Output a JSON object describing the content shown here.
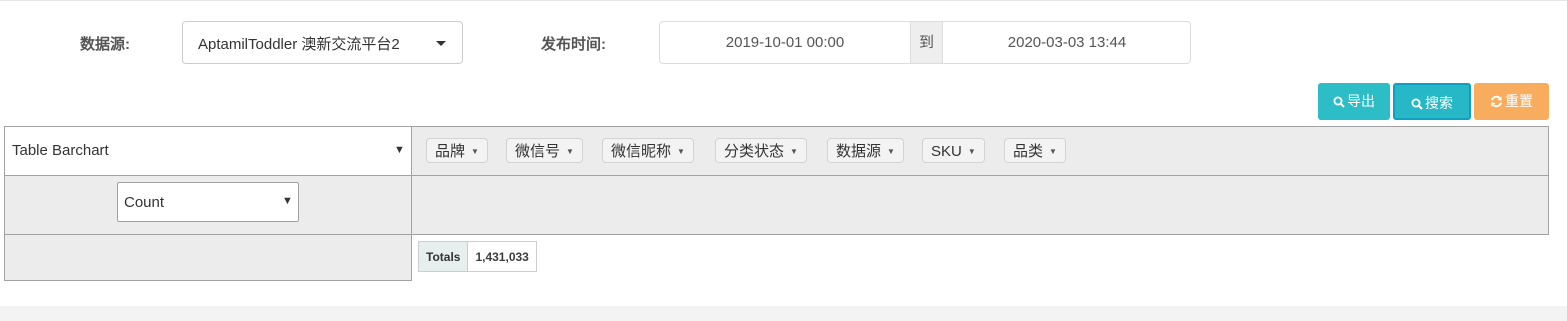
{
  "filters": {
    "source_label": "数据源:",
    "source_value": "AptamilToddler 澳新交流平台2",
    "time_label": "发布时间:",
    "date_from": "2019-10-01 00:00",
    "date_separator": "到",
    "date_to": "2020-03-03 13:44"
  },
  "actions": {
    "export_label": "导出",
    "search_label": "搜索",
    "reset_label": "重置"
  },
  "pivot": {
    "renderer": "Table Barchart",
    "aggregator": "Count",
    "attributes": [
      "品牌",
      "微信号",
      "微信昵称",
      "分类状态",
      "数据源",
      "SKU",
      "品类"
    ],
    "totals_label": "Totals",
    "totals_value": "1,431,033"
  },
  "icons": {
    "export": "search-icon",
    "search": "search-icon",
    "reset": "refresh-icon"
  },
  "colors": {
    "export_button": "#2dbdc6",
    "search_button": "#26b8c6",
    "reset_button": "#f8ad5e"
  }
}
